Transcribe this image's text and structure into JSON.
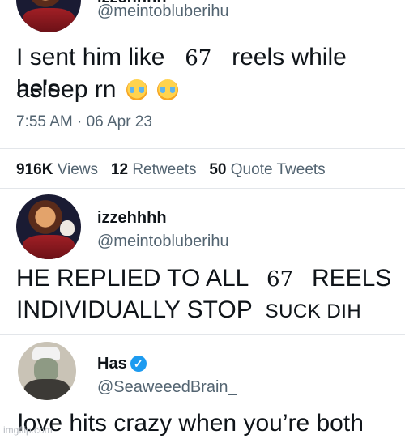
{
  "tweet1": {
    "name_partial": "izzehhhh",
    "handle": "@meintobluberihu",
    "text_start": "I sent him like",
    "overlay_number": "67",
    "text_end": "reels while he's",
    "text_line2": "asleep rn",
    "emoji": [
      "loudly-crying-face",
      "loudly-crying-face"
    ],
    "timestamp": "7:55 AM · 06 Apr 23"
  },
  "stats": {
    "views_count": "916K",
    "views_label": "Views",
    "retweets_count": "12",
    "retweets_label": "Retweets",
    "quotes_count": "50",
    "quotes_label": "Quote Tweets"
  },
  "reply1": {
    "name": "izzehhhh",
    "handle": "@meintobluberihu",
    "line1_start": "HE REPLIED TO ALL",
    "overlay_number": "67",
    "line1_end": "REELS",
    "line2_start": "INDIVIDUALLY STOP",
    "overlay_text": "SUCK DIH"
  },
  "reply2": {
    "name": "Has",
    "handle": "@SeaweeedBrain_",
    "text": "love hits crazy when you’re both"
  },
  "watermark": "imgflip.com",
  "colors": {
    "text": "#0f1419",
    "secondary": "#536471",
    "verified": "#1d9bf0"
  }
}
